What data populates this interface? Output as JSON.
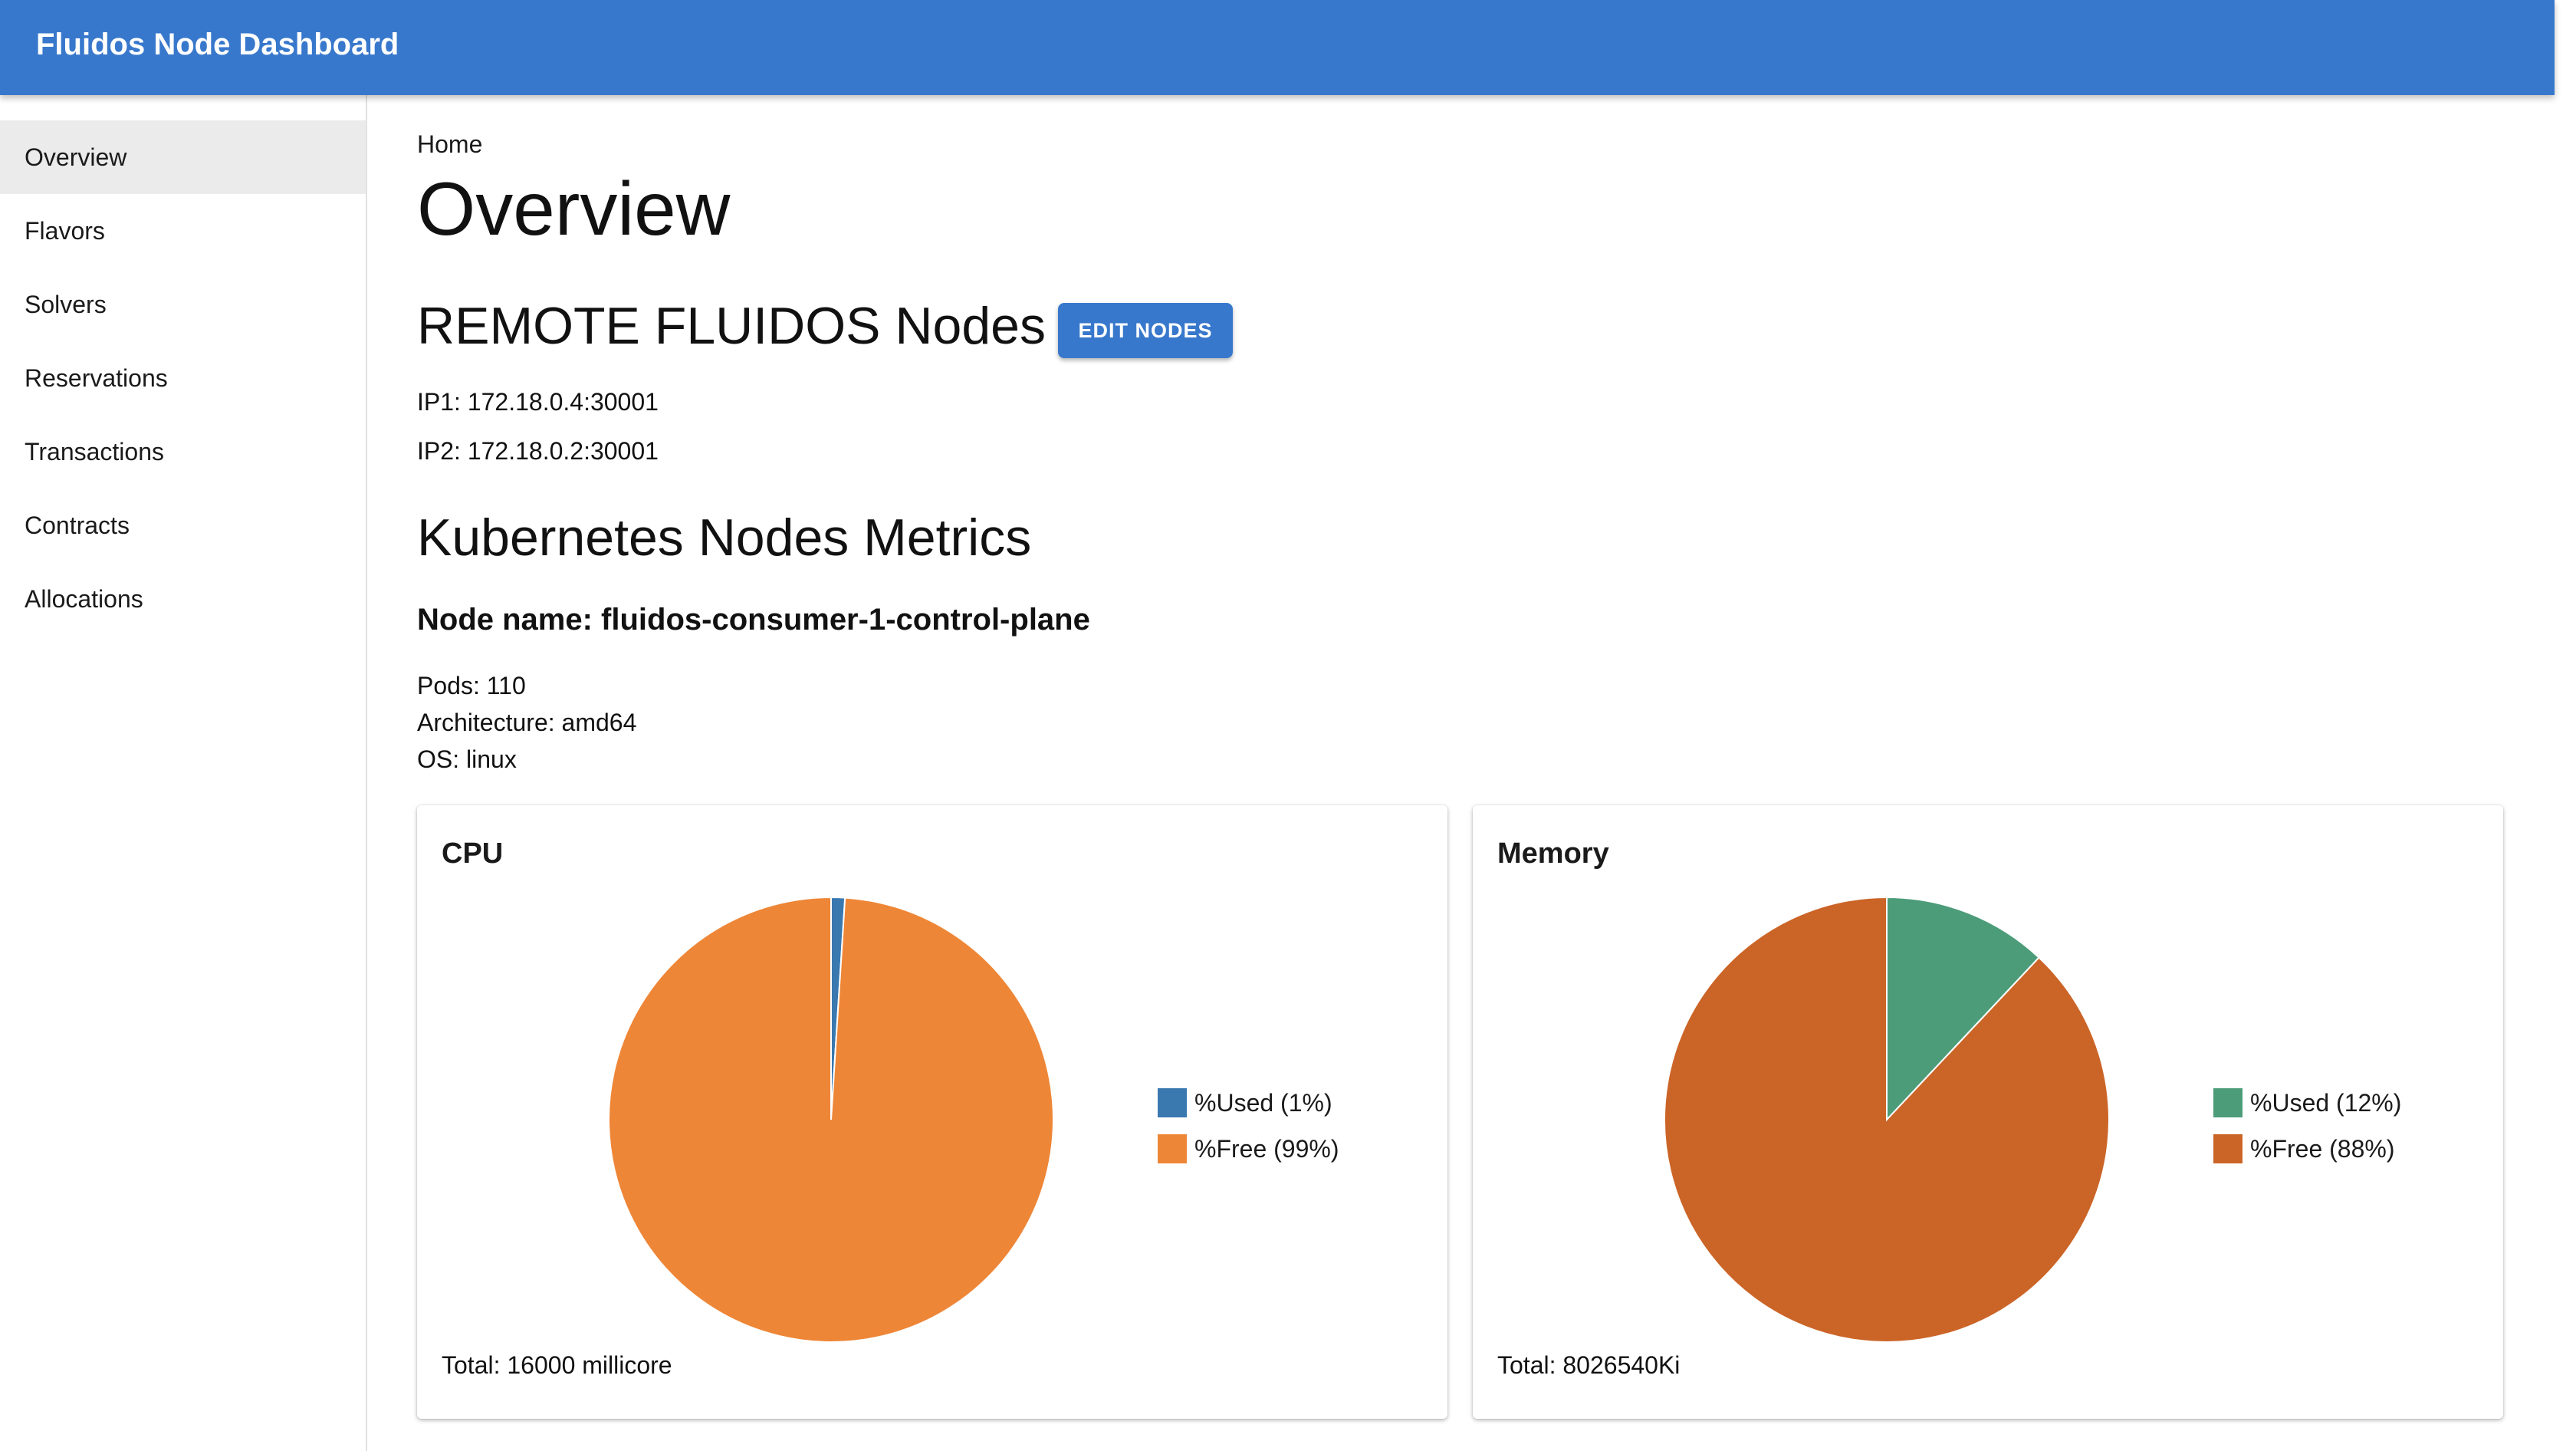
{
  "app": {
    "title": "Fluidos Node Dashboard"
  },
  "sidebar": {
    "items": [
      {
        "label": "Overview",
        "active": true
      },
      {
        "label": "Flavors"
      },
      {
        "label": "Solvers"
      },
      {
        "label": "Reservations"
      },
      {
        "label": "Transactions"
      },
      {
        "label": "Contracts"
      },
      {
        "label": "Allocations"
      }
    ]
  },
  "main": {
    "breadcrumb": "Home",
    "title": "Overview",
    "remote": {
      "title": "REMOTE FLUIDOS Nodes",
      "edit_label": "EDIT NODES",
      "ip1": "IP1: 172.18.0.4:30001",
      "ip2": "IP2: 172.18.0.2:30001"
    },
    "metrics": {
      "title": "Kubernetes Nodes Metrics",
      "node_name": "Node name: fluidos-consumer-1-control-plane",
      "pods": "Pods: 110",
      "architecture": "Architecture: amd64",
      "os": "OS: linux"
    }
  },
  "chart_data": [
    {
      "type": "pie",
      "title": "CPU",
      "labels": [
        "%Used (1%)",
        "%Free (99%)"
      ],
      "values": [
        1,
        99
      ],
      "colors": [
        "#3a78b0",
        "#ee8637"
      ],
      "footer": "Total: 16000 millicore"
    },
    {
      "type": "pie",
      "title": "Memory",
      "labels": [
        "%Used (12%)",
        "%Free (88%)"
      ],
      "values": [
        12,
        88
      ],
      "colors": [
        "#4c9c7a",
        "#cb6427"
      ],
      "footer": "Total: 8026540Ki"
    }
  ]
}
